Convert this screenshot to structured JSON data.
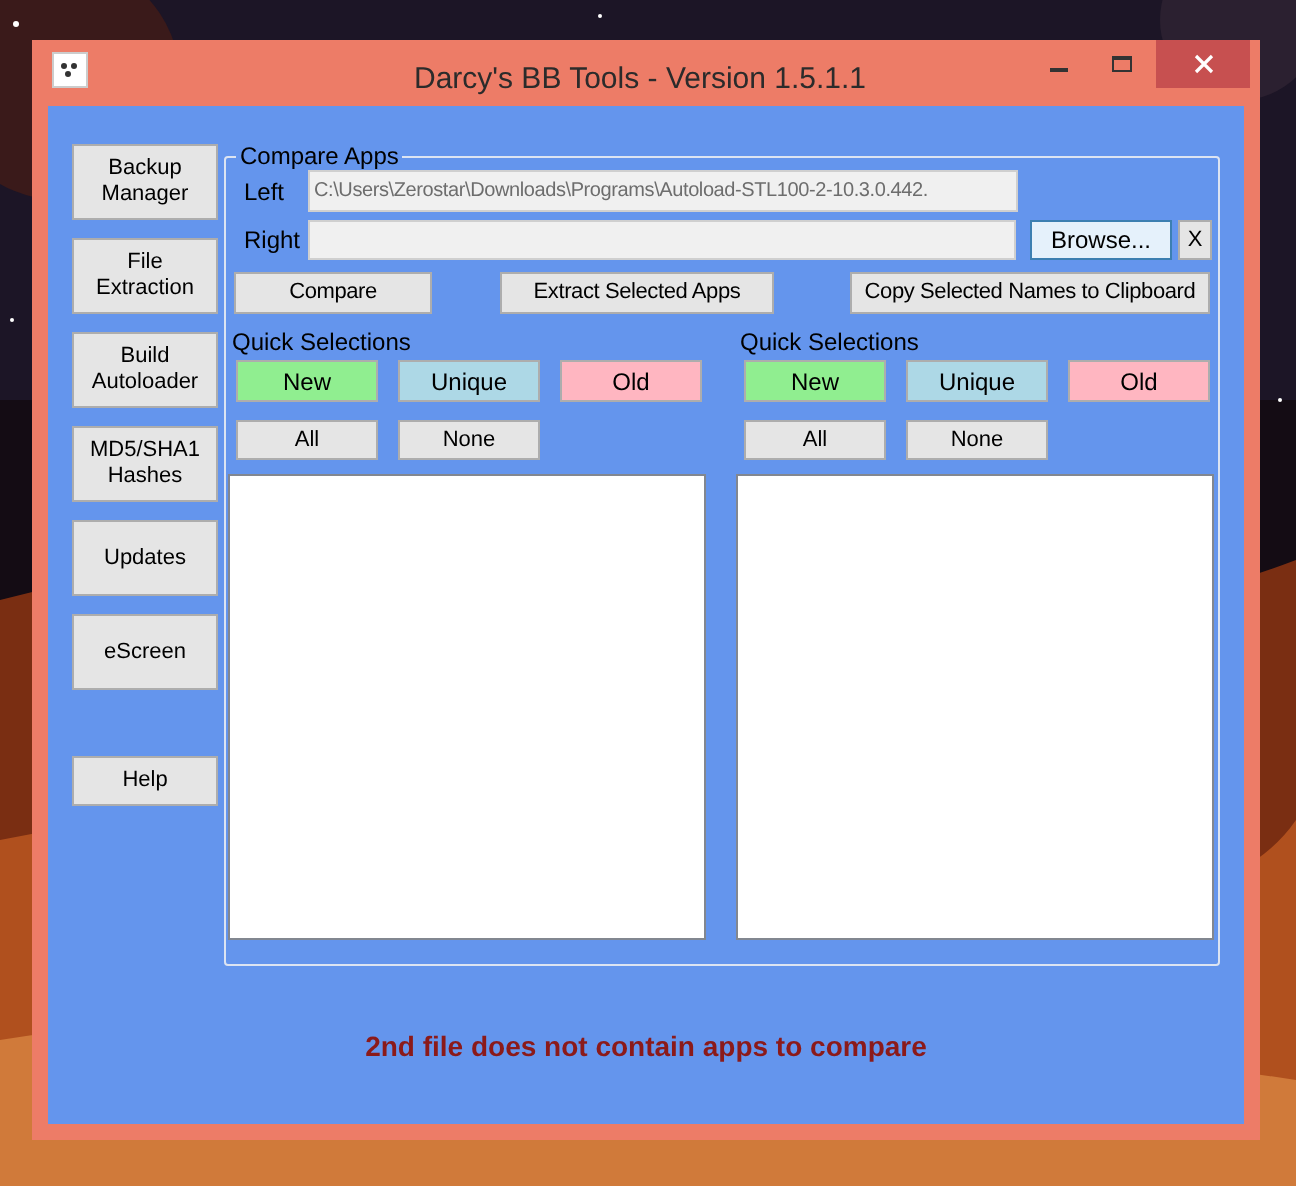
{
  "window": {
    "title": "Darcy's BB Tools - Version 1.5.1.1"
  },
  "sidebar": {
    "buttons": [
      "Backup Manager",
      "File Extraction",
      "Build Autoloader",
      "MD5/SHA1 Hashes",
      "Updates",
      "eScreen"
    ],
    "help": "Help"
  },
  "compare": {
    "title": "Compare Apps",
    "left_label": "Left",
    "left_value": "C:\\Users\\Zerostar\\Downloads\\Programs\\Autoload-STL100-2-10.3.0.442.",
    "right_label": "Right",
    "browse": "Browse...",
    "clear": "X",
    "actions": [
      "Compare",
      "Extract Selected Apps",
      "Copy Selected Names to Clipboard"
    ],
    "panels": [
      {
        "heading": "Quick Selections",
        "selections": [
          {
            "label": "New",
            "color": "#90ee90"
          },
          {
            "label": "Unique",
            "color": "#add8e6"
          },
          {
            "label": "Old",
            "color": "#ffb6c1"
          }
        ],
        "all": "All",
        "none": "None"
      },
      {
        "heading": "Quick Selections",
        "selections": [
          {
            "label": "New",
            "color": "#90ee90"
          },
          {
            "label": "Unique",
            "color": "#add8e6"
          },
          {
            "label": "Old",
            "color": "#ffb6c1"
          }
        ],
        "all": "All",
        "none": "None"
      }
    ]
  },
  "status": "2nd file does not contain apps to compare"
}
